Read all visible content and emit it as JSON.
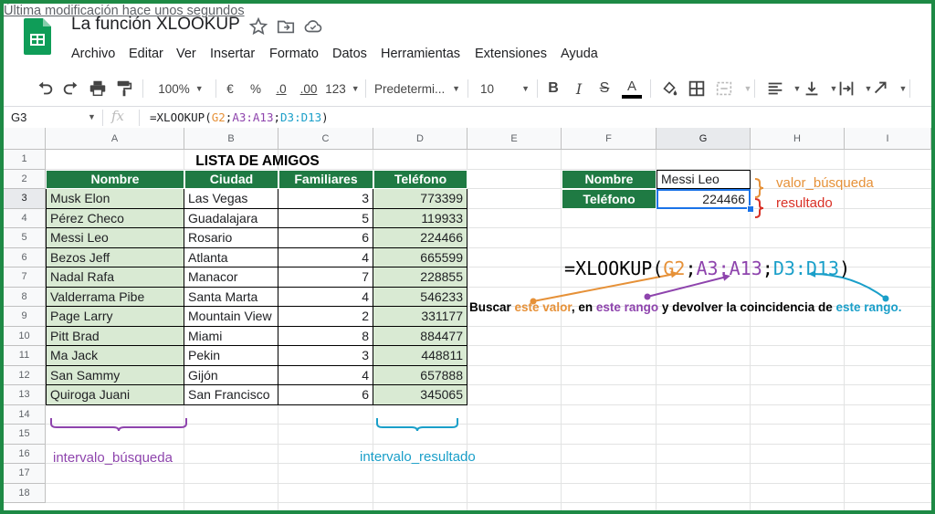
{
  "doc": {
    "title": "La función XLOOKUP",
    "star_icon": "star-icon",
    "move_icon": "folder-move-icon",
    "cloud_icon": "cloud-status-icon",
    "logo_color": "#0f9d58"
  },
  "menu": [
    "Archivo",
    "Editar",
    "Ver",
    "Insertar",
    "Formato",
    "Datos",
    "Herramientas",
    "Extensiones",
    "Ayuda"
  ],
  "last_edit": "Última modificación hace unos segundos",
  "toolbar": {
    "zoom": "100%",
    "currency": "€",
    "percent": "%",
    "dec_decrease": ".0",
    "dec_increase": ".00",
    "more_formats": "123",
    "font": "Predetermi...",
    "font_size": "10",
    "bold": "B",
    "italic": "I",
    "strike": "S",
    "text_color": "A"
  },
  "formula_bar": {
    "cell_ref": "G3",
    "fx": "fx",
    "formula_parts": [
      {
        "text": "=XLOOKUP(",
        "color": "#202124"
      },
      {
        "text": "G2",
        "color": "#e69138"
      },
      {
        "text": ";",
        "color": "#202124"
      },
      {
        "text": "A3:A13",
        "color": "#8e44ad"
      },
      {
        "text": ";",
        "color": "#202124"
      },
      {
        "text": "D3:D13",
        "color": "#1a9fc9"
      },
      {
        "text": ")",
        "color": "#202124"
      }
    ]
  },
  "grid": {
    "columns": [
      "A",
      "B",
      "C",
      "D",
      "E",
      "F",
      "G",
      "H",
      "I"
    ],
    "rows": [
      "1",
      "2",
      "3",
      "4",
      "5",
      "6",
      "7",
      "8",
      "9",
      "10",
      "11",
      "12",
      "13",
      "14",
      "15",
      "16",
      "17",
      "18"
    ],
    "selected_column": "G",
    "selected_row": "3"
  },
  "table": {
    "title": "LISTA DE AMIGOS",
    "headers": [
      "Nombre",
      "Ciudad",
      "Familiares",
      "Teléfono"
    ],
    "rows": [
      [
        "Musk Elon",
        "Las Vegas",
        "3",
        "773399"
      ],
      [
        "Pérez Checo",
        "Guadalajara",
        "5",
        "119933"
      ],
      [
        "Messi Leo",
        "Rosario",
        "6",
        "224466"
      ],
      [
        "Bezos Jeff",
        "Atlanta",
        "4",
        "665599"
      ],
      [
        "Nadal Rafa",
        "Manacor",
        "7",
        "228855"
      ],
      [
        "Valderrama Pibe",
        "Santa Marta",
        "4",
        "546233"
      ],
      [
        "Page Larry",
        "Mountain View",
        "2",
        "331177"
      ],
      [
        "Pitt Brad",
        "Miami",
        "8",
        "884477"
      ],
      [
        "Ma Jack",
        "Pekin",
        "3",
        "448811"
      ],
      [
        "San Sammy",
        "Gijón",
        "4",
        "657888"
      ],
      [
        "Quiroga Juani",
        "San Francisco",
        "6",
        "345065"
      ]
    ]
  },
  "lookup": {
    "name_label": "Nombre",
    "name_value": "Messi Leo",
    "phone_label": "Teléfono",
    "phone_value": "224466"
  },
  "annotations": {
    "valor_busqueda": "valor_búsqueda",
    "resultado": "resultado",
    "intervalo_busqueda": "intervalo_búsqueda",
    "intervalo_resultado": "intervalo_resultado",
    "orange": "#e69138",
    "red": "#d93025",
    "purple": "#8e44ad",
    "teal": "#1a9fc9"
  },
  "big_formula": [
    {
      "text": "=XLOOKUP(",
      "color": "#000000"
    },
    {
      "text": "G2",
      "color": "#e69138"
    },
    {
      "text": ";",
      "color": "#000000"
    },
    {
      "text": "A3:A13",
      "color": "#8e44ad"
    },
    {
      "text": ";",
      "color": "#000000"
    },
    {
      "text": "D3:D13",
      "color": "#1a9fc9"
    },
    {
      "text": ")",
      "color": "#000000"
    }
  ],
  "explanation": [
    {
      "text": "Buscar ",
      "color": "#000000"
    },
    {
      "text": "este valor",
      "color": "#e69138"
    },
    {
      "text": ", en ",
      "color": "#000000"
    },
    {
      "text": "este rango",
      "color": "#8e44ad"
    },
    {
      "text": " y devolver la coincidencia de ",
      "color": "#000000"
    },
    {
      "text": "este rango.",
      "color": "#1a9fc9"
    }
  ]
}
